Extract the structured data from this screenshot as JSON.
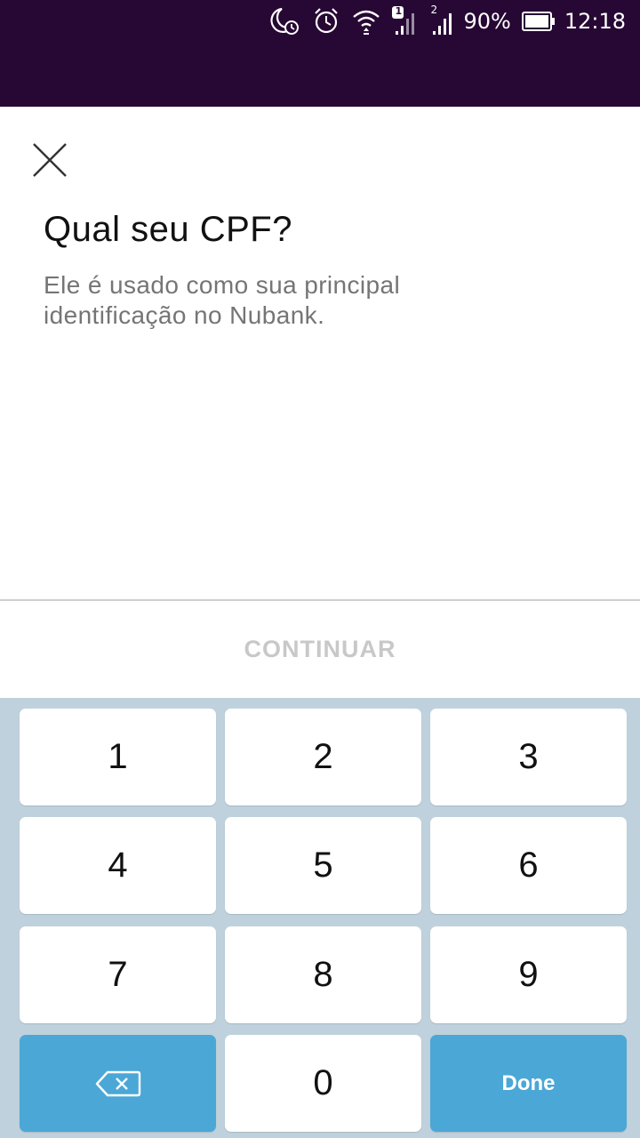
{
  "status_bar": {
    "background": "#270734",
    "icons": [
      "moon-alarm-icon",
      "alarm-clock-icon",
      "wifi-icon",
      "signal-sim1-icon",
      "signal-sim2-icon",
      "battery-icon"
    ],
    "sim1_badge": "1",
    "sim2_badge": "2",
    "battery_percent": "90%",
    "time": "12:18"
  },
  "screen": {
    "close_icon": "close-icon",
    "title": "Qual seu CPF?",
    "subtitle": "Ele é usado como sua principal identificação no Nubank."
  },
  "footer": {
    "continue_label": "CONTINUAR"
  },
  "keypad": {
    "keys": [
      "1",
      "2",
      "3",
      "4",
      "5",
      "6",
      "7",
      "8",
      "9"
    ],
    "zero": "0",
    "backspace_icon": "backspace-icon",
    "done_label": "Done",
    "key_bg": "#ffffff",
    "action_bg": "#4ba7d6",
    "keyboard_bg": "#bfd1dc"
  }
}
